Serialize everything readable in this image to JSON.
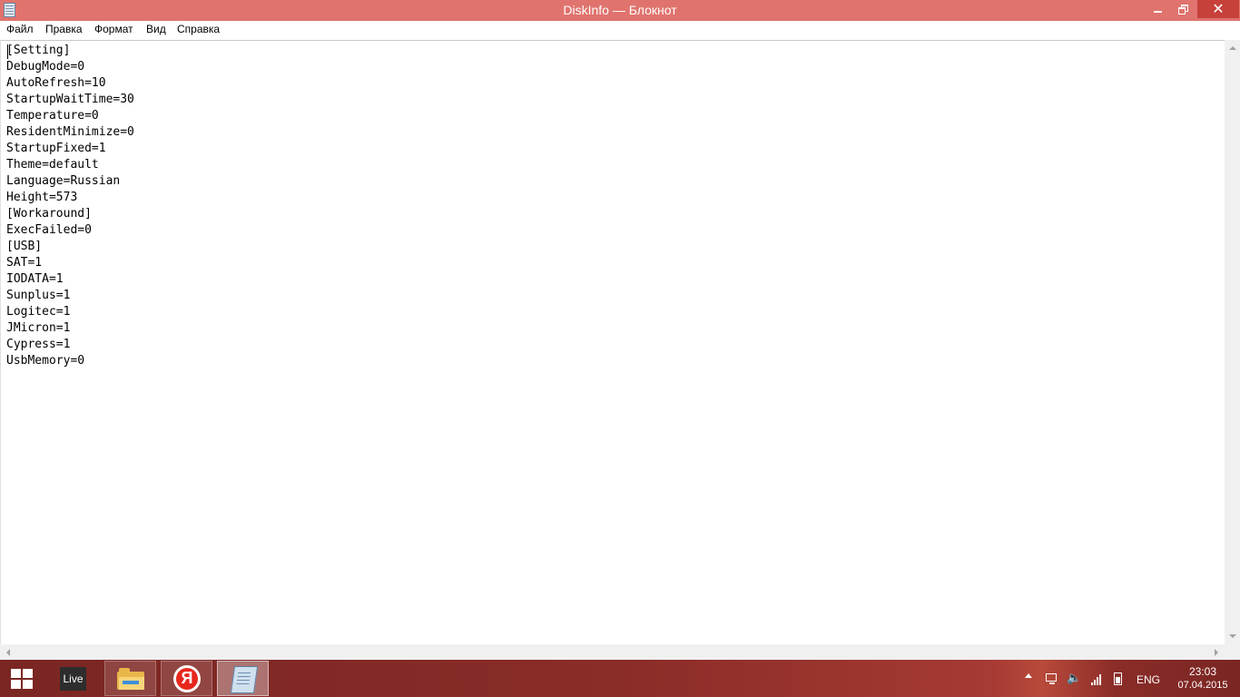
{
  "window": {
    "title": "DiskInfo — Блокнот",
    "close_glyph": "✕"
  },
  "menu": {
    "items": [
      "Файл",
      "Правка",
      "Формат",
      "Вид",
      "Справка"
    ]
  },
  "editor": {
    "lines": [
      "[Setting]",
      "DebugMode=0",
      "AutoRefresh=10",
      "StartupWaitTime=30",
      "Temperature=0",
      "ResidentMinimize=0",
      "StartupFixed=1",
      "Theme=default",
      "Language=Russian",
      "Height=573",
      "[Workaround]",
      "ExecFailed=0",
      "[USB]",
      "SAT=1",
      "IODATA=1",
      "Sunplus=1",
      "Logitec=1",
      "JMicron=1",
      "Cypress=1",
      "UsbMemory=0"
    ]
  },
  "taskbar": {
    "live_tile_label": "Live",
    "yandex_glyph": "Я",
    "apps": [
      {
        "icon": "file-explorer-icon"
      },
      {
        "icon": "yandex-browser-icon"
      },
      {
        "icon": "notepad-icon",
        "active": true
      }
    ]
  },
  "tray": {
    "language": "ENG",
    "volume_glyph": "🔈",
    "time": "23:03",
    "date": "07.04.2015"
  },
  "colors": {
    "titlebar": "#e0736d",
    "close_button": "#c7403a",
    "taskbar": "#7a2623"
  }
}
